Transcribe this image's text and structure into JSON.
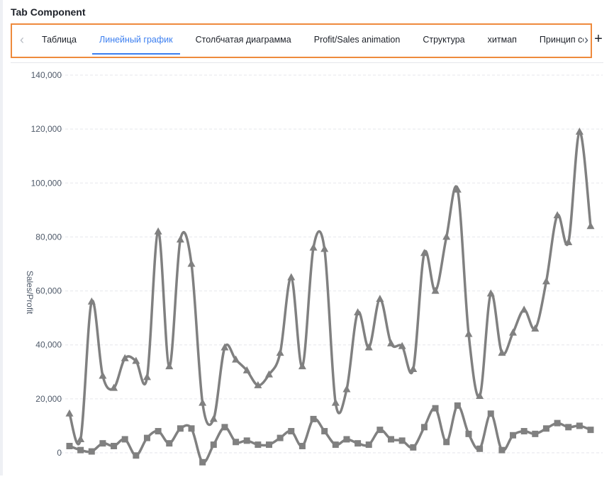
{
  "component_title": "Tab Component",
  "tabs": [
    {
      "label": "Таблица",
      "active": false
    },
    {
      "label": "Линейный график",
      "active": true
    },
    {
      "label": "Столбчатая диаграмма",
      "active": false
    },
    {
      "label": "Profit/Sales animation",
      "active": false
    },
    {
      "label": "Структура",
      "active": false
    },
    {
      "label": "хитмап",
      "active": false
    },
    {
      "label": "Принцип соединения",
      "active": false
    }
  ],
  "icons": {
    "scroll_left": "chevron-left-icon",
    "scroll_right": "chevron-right-icon",
    "add": "plus-icon"
  },
  "colors": {
    "accent": "#3c7ff0",
    "highlight_border": "#ee8a3c",
    "series": "#808080"
  },
  "chart_data": {
    "type": "line",
    "ylabel": "Sales/Profit",
    "ylim": [
      0,
      140000
    ],
    "yticks": [
      "0",
      "20,000",
      "40,000",
      "60,000",
      "80,000",
      "100,000",
      "120,000",
      "140,000"
    ],
    "grid": true,
    "smooth": true,
    "series": [
      {
        "marker": "triangle",
        "values": [
          14500,
          5000,
          56000,
          28500,
          24000,
          35000,
          34000,
          28000,
          82000,
          32000,
          79000,
          70000,
          18500,
          12500,
          39000,
          34500,
          30500,
          25000,
          29000,
          37000,
          65000,
          32000,
          76000,
          75500,
          18500,
          23500,
          52000,
          39000,
          57000,
          40500,
          39500,
          31000,
          74000,
          60000,
          80000,
          97500,
          44000,
          21000,
          59000,
          37000,
          44500,
          53000,
          46000,
          63500,
          88000,
          78000,
          119000,
          84000
        ]
      },
      {
        "marker": "square",
        "values": [
          2500,
          1000,
          500,
          3500,
          2500,
          5000,
          -1000,
          5500,
          8000,
          3500,
          9000,
          9000,
          -3500,
          3000,
          9500,
          4000,
          4500,
          3000,
          3000,
          5500,
          8000,
          2500,
          12500,
          8000,
          3000,
          5000,
          3500,
          3000,
          8500,
          5000,
          4500,
          2000,
          9500,
          16500,
          4000,
          17500,
          7000,
          1500,
          14500,
          1000,
          6500,
          8000,
          7000,
          9000,
          11000,
          9500,
          10000,
          8500
        ]
      }
    ]
  }
}
